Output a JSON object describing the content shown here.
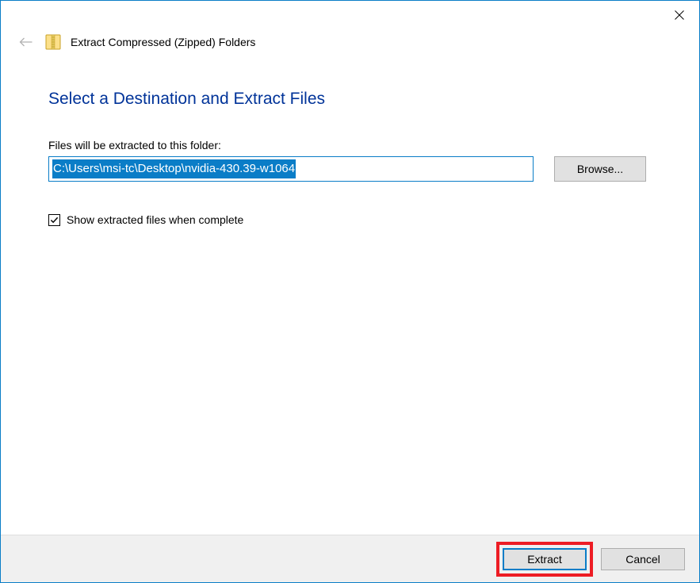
{
  "window": {
    "wizard_title": "Extract Compressed (Zipped) Folders"
  },
  "main": {
    "heading": "Select a Destination and Extract Files",
    "path_label": "Files will be extracted to this folder:",
    "path_value": "C:\\Users\\msi-tc\\Desktop\\nvidia-430.39-w1064",
    "browse_label": "Browse...",
    "checkbox_label": "Show extracted files when complete",
    "checkbox_checked": true
  },
  "footer": {
    "extract_label": "Extract",
    "cancel_label": "Cancel"
  }
}
